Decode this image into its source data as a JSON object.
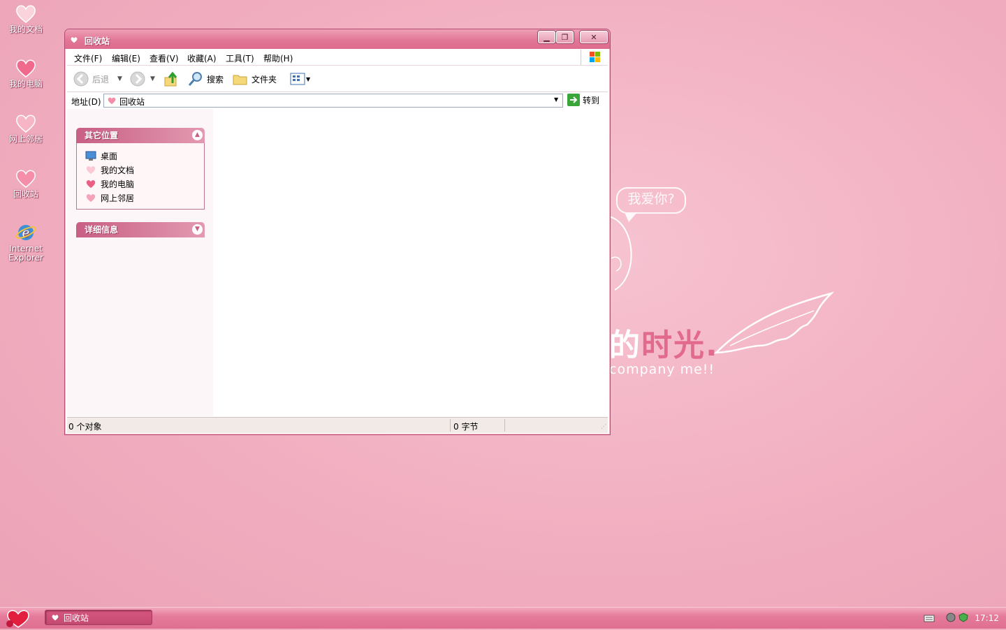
{
  "desktop": {
    "icons": [
      {
        "label": "我的文档"
      },
      {
        "label": "我的电脑"
      },
      {
        "label": "网上邻居"
      },
      {
        "label": "回收站"
      },
      {
        "label": "Internet Explorer"
      }
    ]
  },
  "wallpaper": {
    "bubble_text": "我爱你?",
    "title_dim": "的",
    "title_main": "时光.",
    "subtitle": "company me!!"
  },
  "window": {
    "title": "回收站",
    "menu": [
      "文件(F)",
      "编辑(E)",
      "查看(V)",
      "收藏(A)",
      "工具(T)",
      "帮助(H)"
    ],
    "toolbar": {
      "back_label": "后退",
      "search_label": "搜索",
      "folders_label": "文件夹"
    },
    "address": {
      "label": "地址(D)",
      "value": "回收站",
      "go_label": "转到"
    },
    "panels": {
      "other_places": {
        "title": "其它位置",
        "items": [
          "桌面",
          "我的文档",
          "我的电脑",
          "网上邻居"
        ]
      },
      "details": {
        "title": "详细信息"
      }
    },
    "status": {
      "objects": "0 个对象",
      "bytes": "0 字节"
    }
  },
  "taskbar": {
    "task_label": "回收站",
    "clock": "17:12"
  },
  "colors": {
    "accent": "#e27797",
    "panel_header": "#c85e84",
    "desktop": "#f1aec0"
  }
}
